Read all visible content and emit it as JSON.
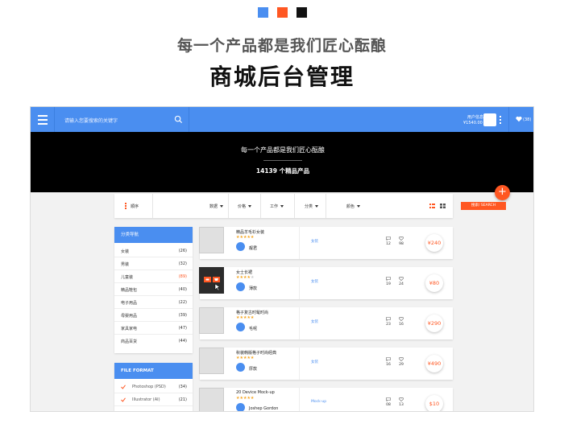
{
  "colors": {
    "sq1": "#4a8ef0",
    "sq2": "#ff5722",
    "sq3": "#111111",
    "accent": "#4a8ef0",
    "orange": "#ff5722"
  },
  "heading": {
    "subtitle": "每一个产品都是我们匠心酝酿",
    "title": "商城后台管理"
  },
  "topbar": {
    "search_placeholder": "请输入您要搜索的关键字",
    "user_label": "用户信息",
    "user_balance": "¥1540.00",
    "fav_count": "(38)"
  },
  "hero": {
    "title": "每一个产品都是我们匠心酝酿",
    "count": "14139 个精品产品"
  },
  "fab": {
    "label": "+"
  },
  "filters": {
    "sort": "顺序",
    "items": [
      "数据",
      "价格",
      "工作",
      "分类",
      "颜色"
    ],
    "search_button": "搜索/ SEARCH"
  },
  "sidebar": {
    "title": "分类导航",
    "items": [
      {
        "name": "女装",
        "count": "(26)"
      },
      {
        "name": "男装",
        "count": "(32)"
      },
      {
        "name": "儿童装",
        "count": "(89)"
      },
      {
        "name": "精品鞋包",
        "count": "(40)"
      },
      {
        "name": "电子用品",
        "count": "(22)"
      },
      {
        "name": "母婴用品",
        "count": "(39)"
      },
      {
        "name": "家具家电",
        "count": "(47)"
      },
      {
        "name": "商品百货",
        "count": "(44)"
      }
    ]
  },
  "format": {
    "title": "FILE FORMAT",
    "items": [
      {
        "name": "Photoshop (PSD)",
        "count": "(34)"
      },
      {
        "name": "Illustrator (AI)",
        "count": "(21)"
      }
    ]
  },
  "products": [
    {
      "name": "精品羊毛衫女装",
      "rating": 5,
      "author": "靓君",
      "category": "女装",
      "comments": "12",
      "likes": "98",
      "price": "¥240"
    },
    {
      "name": "女士长裙",
      "rating": 4,
      "author": "薄款",
      "category": "女装",
      "comments": "19",
      "likes": "24",
      "price": "¥80"
    },
    {
      "name": "格子复古时髦时尚",
      "rating": 5,
      "author": "毛呢",
      "category": "女装",
      "comments": "23",
      "likes": "16",
      "price": "¥290"
    },
    {
      "name": "秋装韩版格子时尚经典",
      "rating": 5,
      "author": "厚款",
      "category": "女装",
      "comments": "16",
      "likes": "29",
      "price": "¥490"
    },
    {
      "name": "20 Device Mock-up",
      "rating": 5,
      "author": "Joshep Gordon",
      "category": "Mock-up",
      "comments": "08",
      "likes": "13",
      "price": "$10"
    }
  ]
}
